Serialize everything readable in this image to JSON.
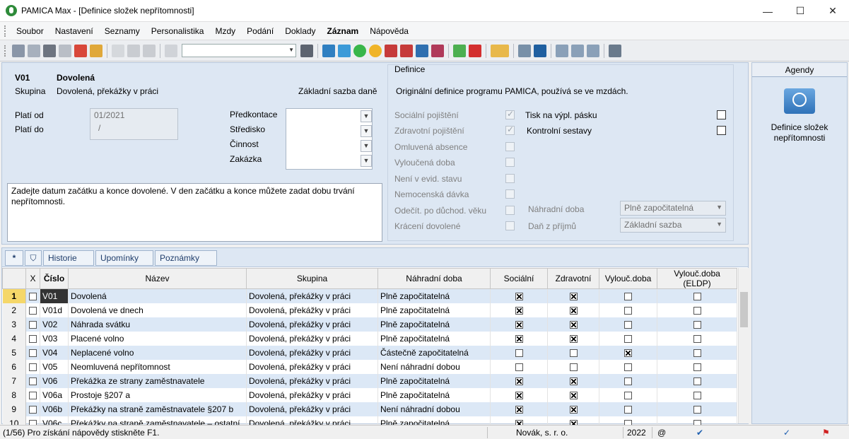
{
  "window": {
    "title": "PAMICA Max - [Definice složek nepřítomnosti]"
  },
  "menu": [
    "Soubor",
    "Nastavení",
    "Seznamy",
    "Personalistika",
    "Mzdy",
    "Podání",
    "Doklady",
    "Záznam",
    "Nápověda"
  ],
  "detail": {
    "code": "V01",
    "name": "Dovolená",
    "group_label": "Skupina",
    "group_value": "Dovolená, překážky v práci",
    "base_label": "Základní sazba daně",
    "valid_from_label": "Platí od",
    "valid_to_label": "Platí do",
    "valid_from": "01/2021",
    "valid_to": "/",
    "predkontace": "Předkontace",
    "stredisko": "Středisko",
    "cinnost": "Činnost",
    "zakazka": "Zakázka",
    "note": "Zadejte datum začátku a konce dovolené. V den začátku a konce můžete zadat dobu trvání nepřítomnosti.",
    "definition_title": "Definice",
    "definition_text": "Originální definice programu PAMICA, používá se ve mzdách.",
    "flags": [
      "Sociální pojištění",
      "Zdravotní pojištění",
      "Omluvená absence",
      "Vyloučená doba",
      "Není v evid. stavu",
      "Nemocenská dávka",
      "Odečít. po důchod. věku",
      "Krácení dovolené"
    ],
    "tisk": "Tisk na výpl. pásku",
    "kontrol": "Kontrolní sestavy",
    "nahradni_label": "Náhradní doba",
    "nahradni_value": "Plně započitatelná",
    "dan_label": "Daň z příjmů",
    "dan_value": "Základní sazba"
  },
  "tabs": {
    "star": "*",
    "historie": "Historie",
    "upominky": "Upomínky",
    "poznamky": "Poznámky"
  },
  "table": {
    "headers": [
      "X",
      "Číslo",
      "Název",
      "Skupina",
      "Náhradní doba",
      "Sociální",
      "Zdravotní",
      "Vylouč.doba",
      "Vylouč.doba (ELDP)"
    ],
    "rows": [
      {
        "n": "1",
        "code": "V01",
        "name": "Dovolená",
        "group": "Dovolená, překážky v práci",
        "sub": "Plně započitatelná",
        "soc": true,
        "zdr": true,
        "vyl": false,
        "eldp": false
      },
      {
        "n": "2",
        "code": "V01d",
        "name": "Dovolená ve dnech",
        "group": "Dovolená, překážky v práci",
        "sub": "Plně započitatelná",
        "soc": true,
        "zdr": true,
        "vyl": false,
        "eldp": false
      },
      {
        "n": "3",
        "code": "V02",
        "name": "Náhrada svátku",
        "group": "Dovolená, překážky v práci",
        "sub": "Plně započitatelná",
        "soc": true,
        "zdr": true,
        "vyl": false,
        "eldp": false
      },
      {
        "n": "4",
        "code": "V03",
        "name": "Placené volno",
        "group": "Dovolená, překážky v práci",
        "sub": "Plně započitatelná",
        "soc": true,
        "zdr": true,
        "vyl": false,
        "eldp": false
      },
      {
        "n": "5",
        "code": "V04",
        "name": "Neplacené volno",
        "group": "Dovolená, překážky v práci",
        "sub": "Částečně započitatelná",
        "soc": false,
        "zdr": false,
        "vyl": true,
        "eldp": false
      },
      {
        "n": "6",
        "code": "V05",
        "name": "Neomluvená nepřítomnost",
        "group": "Dovolená, překážky v práci",
        "sub": "Není náhradní dobou",
        "soc": false,
        "zdr": false,
        "vyl": false,
        "eldp": false
      },
      {
        "n": "7",
        "code": "V06",
        "name": "Překážka ze strany zaměstnavatele",
        "group": "Dovolená, překážky v práci",
        "sub": "Plně započitatelná",
        "soc": true,
        "zdr": true,
        "vyl": false,
        "eldp": false
      },
      {
        "n": "8",
        "code": "V06a",
        "name": "Prostoje §207 a",
        "group": "Dovolená, překážky v práci",
        "sub": "Plně započitatelná",
        "soc": true,
        "zdr": true,
        "vyl": false,
        "eldp": false
      },
      {
        "n": "9",
        "code": "V06b",
        "name": "Překážky na straně zaměstnavatele §207 b",
        "group": "Dovolená, překážky v práci",
        "sub": "Není náhradní dobou",
        "soc": true,
        "zdr": true,
        "vyl": false,
        "eldp": false
      },
      {
        "n": "10",
        "code": "V06c",
        "name": "Překážky na straně zaměstnavatele – ostatní",
        "group": "Dovolená, překážky v práci",
        "sub": "Plně započitatelná",
        "soc": true,
        "zdr": true,
        "vyl": false,
        "eldp": false
      }
    ]
  },
  "side": {
    "title": "Agendy",
    "item": "Definice složek nepřítomnosti"
  },
  "status": {
    "hint": "(1/56) Pro získání nápovědy stiskněte F1.",
    "company": "Novák, s. r. o.",
    "year": "2022",
    "at": "@"
  }
}
